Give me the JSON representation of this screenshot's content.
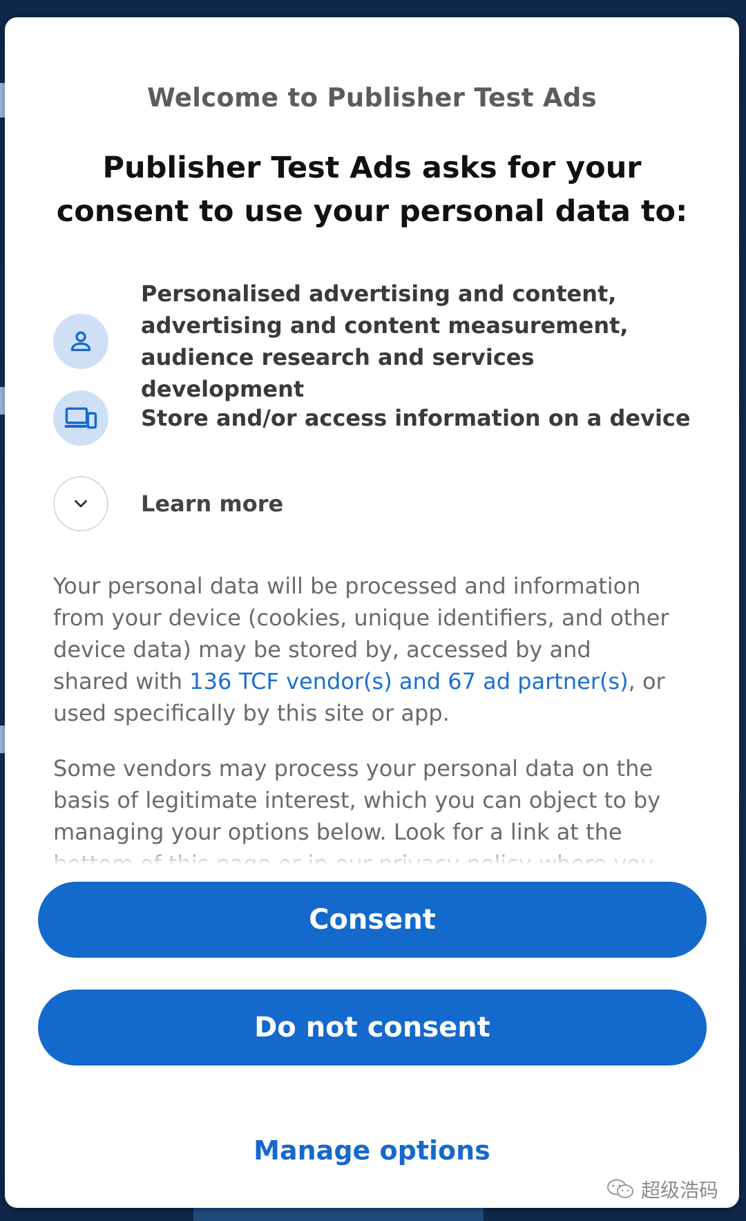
{
  "dialog": {
    "welcome_title": "Welcome to Publisher Test Ads",
    "headline": "Publisher Test Ads asks for your consent to use your personal data to:",
    "purposes": [
      {
        "icon": "person-icon",
        "label": "Personalised advertising and content, advertising and content measurement, audience research and services development"
      },
      {
        "icon": "devices-icon",
        "label": "Store and/or access information on a device"
      }
    ],
    "learn_more": {
      "icon": "chevron-down-icon",
      "label": "Learn more"
    },
    "body": {
      "p1_before": "Your personal data will be processed and information from your device (cookies, unique identifiers, and other device data) may be stored by, accessed by and shared with ",
      "p1_link": "136 TCF vendor(s) and 67 ad partner(s)",
      "p1_after": ", or used specifically by this site or app.",
      "p2": "Some vendors may process your personal data on the basis of legitimate interest, which you can object to by managing your options below. Look for a link at the bottom of this page or in our privacy policy where you"
    },
    "buttons": {
      "consent": "Consent",
      "do_not_consent": "Do not consent",
      "manage_options": "Manage options"
    }
  },
  "watermark": {
    "icon": "wechat-icon",
    "text": "超级浩码"
  },
  "colors": {
    "accent": "#1469cc",
    "link": "#1a6fd1",
    "icon_bg": "#cfe0f6"
  }
}
